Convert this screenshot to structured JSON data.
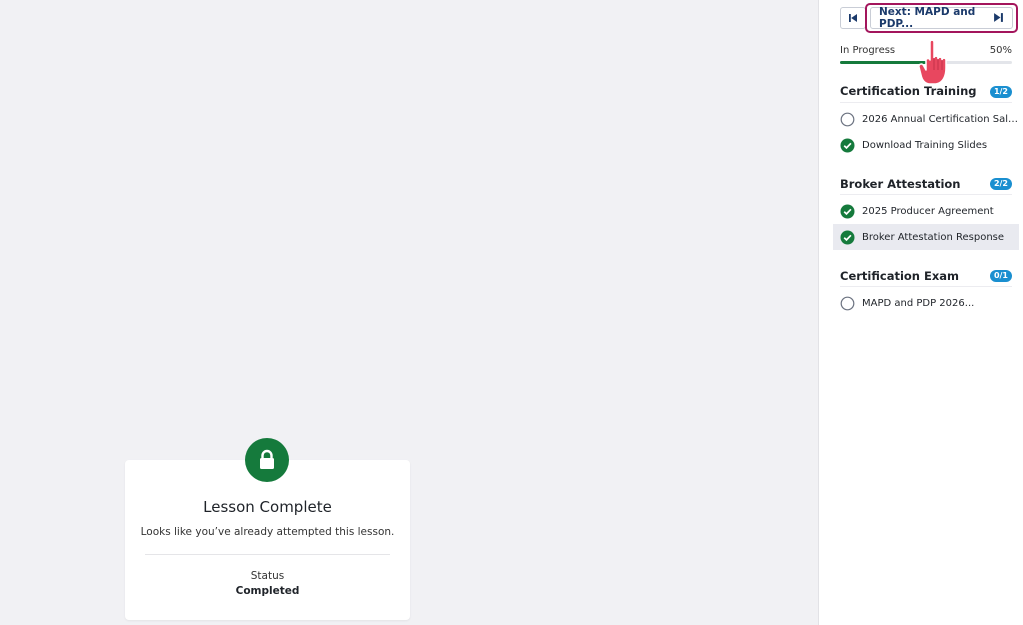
{
  "lesson_card": {
    "title": "Lesson Complete",
    "description": "Looks like you’ve already attempted this lesson.",
    "status_label": "Status",
    "status_value": "Completed",
    "icon": "lock-icon"
  },
  "navigation": {
    "prev_icon": "skip-previous-icon",
    "next_label": "Next: MAPD and PDP...",
    "next_icon": "skip-next-icon"
  },
  "progress": {
    "label": "In Progress",
    "percent_text": "50%",
    "value": 0.5,
    "color": "#157a3c"
  },
  "sections": [
    {
      "title": "Certification Training",
      "badge": "1/2",
      "lessons": [
        {
          "label": "2026 Annual Certification Sale...",
          "status": "incomplete"
        },
        {
          "label": "Download Training Slides",
          "status": "complete"
        }
      ]
    },
    {
      "title": "Broker Attestation",
      "badge": "2/2",
      "lessons": [
        {
          "label": "2025 Producer Agreement",
          "status": "complete"
        },
        {
          "label": "Broker Attestation Response",
          "status": "complete",
          "active": true
        }
      ]
    },
    {
      "title": "Certification Exam",
      "badge": "0/1",
      "lessons": [
        {
          "label": "MAPD and PDP 2026...",
          "status": "incomplete"
        }
      ]
    }
  ],
  "colors": {
    "accent_green": "#157a3c",
    "badge_blue": "#1a8fd0",
    "highlight_outline": "#a3155c",
    "pointer": "#e8475f"
  }
}
